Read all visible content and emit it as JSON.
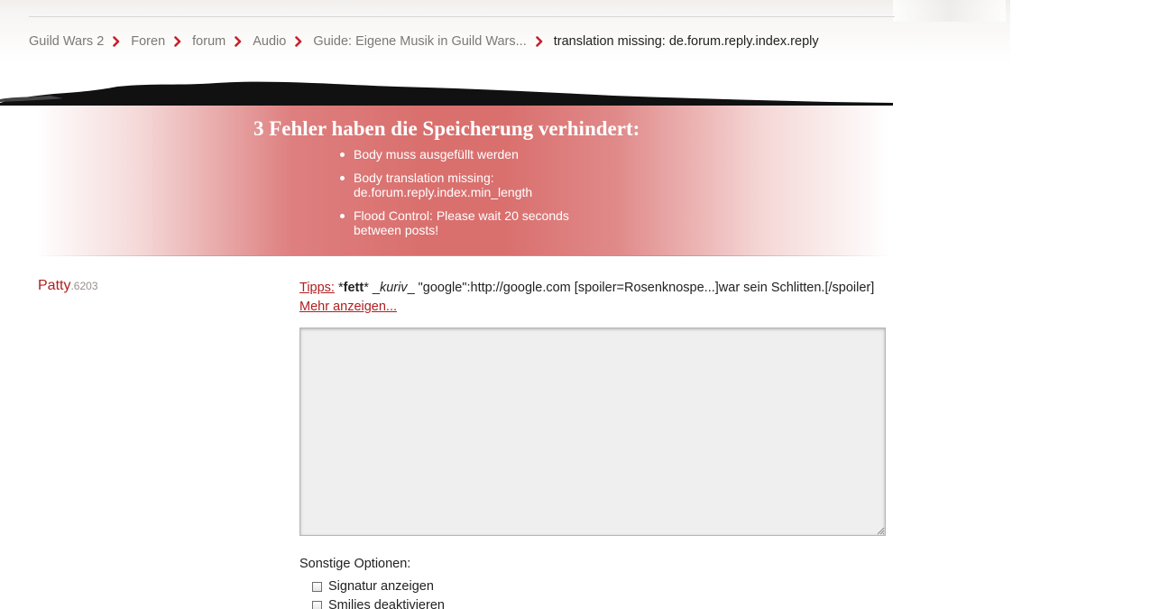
{
  "breadcrumb": {
    "items": [
      "Guild Wars 2",
      "Foren",
      "forum",
      "Audio",
      "Guide: Eigene Musik in Guild Wars..."
    ],
    "current": "translation missing: de.forum.reply.index.reply"
  },
  "errors": {
    "title": "3 Fehler haben die Speicherung verhindert:",
    "items": [
      "Body muss ausgefüllt werden",
      "Body translation missing: de.forum.reply.index.min_length",
      "Flood Control: Please wait 20 seconds between posts!"
    ]
  },
  "user": {
    "name": "Patty",
    "number": ".6203"
  },
  "tips": {
    "label": "Tipps:",
    "bold_example": "fett",
    "italic_example": "kuriv",
    "link_example": "\"google\":http://google.com",
    "spoiler_example": "[spoiler=Rosenknospe...]war sein Schlitten.[/spoiler]",
    "more_link": "Mehr anzeigen..."
  },
  "editor": {
    "value": ""
  },
  "options": {
    "heading": "Sonstige Optionen:",
    "items": [
      {
        "label": "Signatur anzeigen",
        "checked": false
      },
      {
        "label": "Smilies deaktivieren",
        "checked": false
      }
    ]
  },
  "colors": {
    "brand_red": "#b01e1e",
    "error_bg": "#d9706e",
    "chevron": "#c8202a"
  }
}
